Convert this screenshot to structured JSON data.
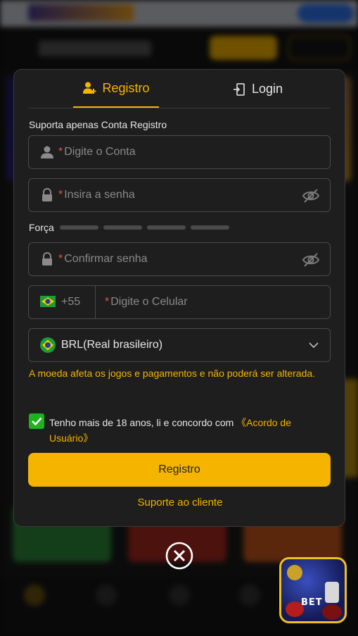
{
  "tabs": {
    "register_label": "Registro",
    "login_label": "Login"
  },
  "form": {
    "support_note": "Suporta apenas Conta Registro",
    "required_mark": "*",
    "account_placeholder": "Digite o Conta",
    "password_placeholder": "Insira a senha",
    "strength_label": "Força",
    "confirm_placeholder": "Confirmar senha",
    "phone_code": "+55",
    "phone_placeholder": "Digite o Celular",
    "currency_value": "BRL(Real brasileiro)",
    "currency_warning": "A moeda afeta os jogos e pagamentos e não poderá ser alterada.",
    "agree_text": "Tenho mais de 18 anos, li e concordo com ",
    "agree_link": "《Acordo de Usuário》",
    "agree_checked": true,
    "submit_label": "Registro",
    "support_link": "Suporte ao cliente"
  },
  "app_icon": {
    "brand_text": "BET"
  },
  "colors": {
    "accent": "#f5b400",
    "required": "#e05252",
    "checkbox": "#1db31d",
    "modal_bg": "#1e1e1e"
  },
  "icons": [
    "add-user-icon",
    "login-door-icon",
    "user-icon",
    "lock-icon",
    "eye-off-icon",
    "brazil-flag-icon",
    "chevron-down-icon",
    "checkmark-icon",
    "close-icon"
  ]
}
